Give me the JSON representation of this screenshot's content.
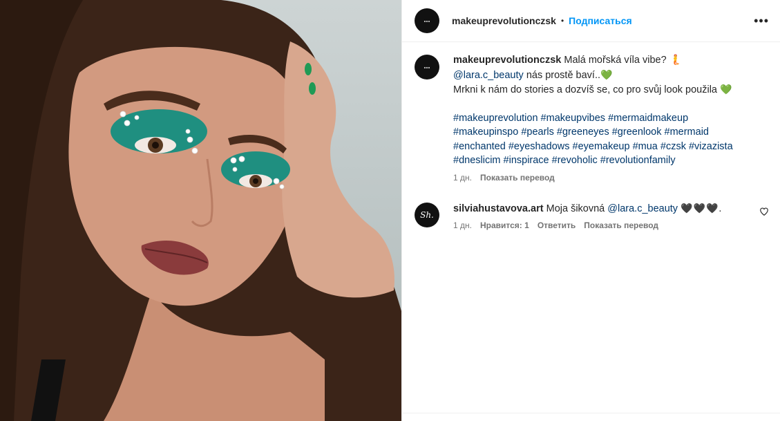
{
  "header": {
    "username": "makeuprevolutionczsk",
    "dot": "•",
    "follow_label": "Подписаться",
    "more_label": "•••"
  },
  "caption": {
    "username": "makeuprevolutionczsk",
    "line1_text": "Malá mořská víla vibe?",
    "line1_emoji": "🧜",
    "mention": "@lara.c_beauty",
    "line2_text": "nás prostě baví..",
    "line2_emoji": "💚",
    "line3_text": "Mrkni k nám do stories a dozvíš se, co pro svůj look použila",
    "line3_emoji": "💚",
    "hashtags_line1": "#makeuprevolution #makeupvibes #mermaidmakeup",
    "hashtags_line2": "#makeupinspo #pearls #greeneyes #greenlook #mermaid",
    "hashtags_line3": "#enchanted #eyeshadows #eyemakeup #mua #czsk #vizazista",
    "hashtags_line4": "#dneslicim #inspirace #revoholic #revolutionfamily",
    "time": "1 дн.",
    "translate_label": "Показать перевод"
  },
  "comment": {
    "username": "silviahustavova.art",
    "text": "Moja šikovná",
    "mention": "@lara.c_beauty",
    "hearts": "🖤🖤🖤",
    "end": ".",
    "time": "1 дн.",
    "likes_label": "Нравится: 1",
    "reply_label": "Ответить",
    "translate_label": "Показать перевод",
    "avatar_monogram": "Sh."
  },
  "icons": {
    "more": "more-horizontal-icon",
    "like": "heart-outline-icon"
  },
  "colors": {
    "link": "#00376b",
    "follow": "#0095f6",
    "meta": "#737373",
    "emoji_heart": "#2ecc40"
  }
}
